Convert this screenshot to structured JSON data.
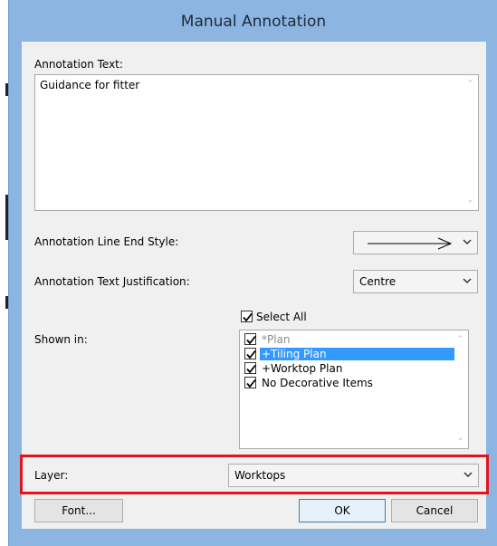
{
  "window": {
    "title": "Manual Annotation"
  },
  "annotation_text": {
    "label": "Annotation Text:",
    "value": "Guidance for fitter"
  },
  "line_end_style": {
    "label": "Annotation Line End Style:",
    "selected": "arrow"
  },
  "text_justification": {
    "label": "Annotation Text Justification:",
    "selected": "Centre"
  },
  "shown_in": {
    "label": "Shown in:",
    "select_all_label": "Select All",
    "select_all_checked": true,
    "items": [
      {
        "label": "*Plan",
        "checked": true,
        "selected": false,
        "disabled": true
      },
      {
        "label": "+Tiling Plan",
        "checked": true,
        "selected": true,
        "disabled": false
      },
      {
        "label": "+Worktop Plan",
        "checked": true,
        "selected": false,
        "disabled": false
      },
      {
        "label": "No Decorative Items",
        "checked": true,
        "selected": false,
        "disabled": false
      }
    ]
  },
  "layer": {
    "label": "Layer:",
    "selected": "Worktops"
  },
  "buttons": {
    "font": "Font...",
    "ok": "OK",
    "cancel": "Cancel"
  },
  "colors": {
    "title_bar": "#8cb5e2",
    "selection": "#3399ff",
    "highlight_box": "#e0151b"
  }
}
